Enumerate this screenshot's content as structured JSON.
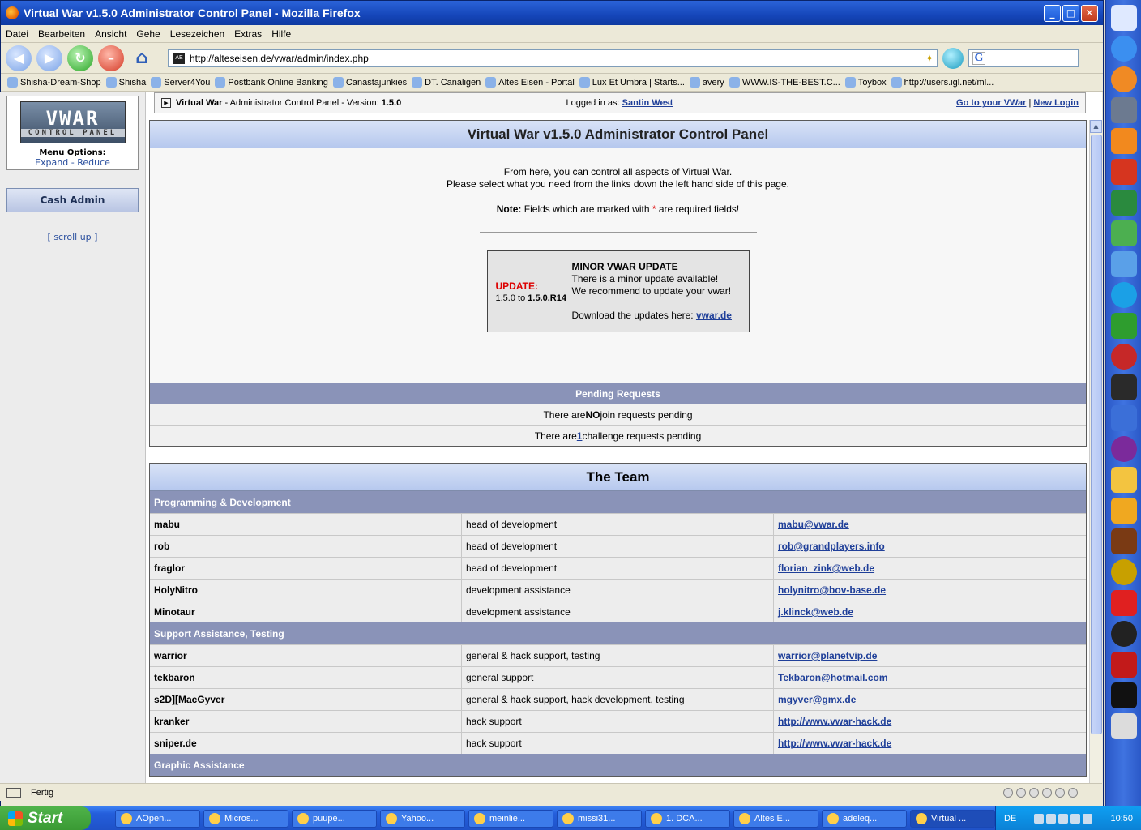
{
  "window": {
    "title": "Virtual War v1.5.0 Administrator Control Panel - Mozilla Firefox"
  },
  "menu": [
    "Datei",
    "Bearbeiten",
    "Ansicht",
    "Gehe",
    "Lesezeichen",
    "Extras",
    "Hilfe"
  ],
  "nav": {
    "url": "http://alteseisen.de/vwar/admin/index.php",
    "search_engine": "G"
  },
  "bookmarks": [
    "Shisha-Dream-Shop",
    "Shisha",
    "Server4You",
    "Postbank Online Banking",
    "Canastajunkies",
    "DT. Canaligen",
    "Altes Eisen - Portal",
    "Lux Et Umbra | Starts...",
    "avery",
    "WWW.IS-THE-BEST.C...",
    "Toybox",
    "http://users.igl.net/ml..."
  ],
  "sidebar": {
    "logo_main": "VWAR",
    "logo_sub": "CONTROL PANEL",
    "menu_options": "Menu Options:",
    "expand": "Expand",
    "sep": "-",
    "reduce": "Reduce",
    "cash_admin": "Cash Admin",
    "scroll_up": "scroll up"
  },
  "infobar": {
    "prefix": "Virtual War",
    "text": " - Administrator Control Panel - Version: ",
    "version": "1.5.0",
    "logged_in_label": "Logged in as: ",
    "user": "Santin West",
    "goto": "Go to your VWar",
    "sep": " | ",
    "new_login": "New Login"
  },
  "main_panel": {
    "title": "Virtual War v1.5.0 Administrator Control Panel",
    "line1": "From here, you can control all aspects of Virtual War.",
    "line2": "Please select what you need from the links down the left hand side of this page.",
    "note_label": "Note:",
    "note_text": " Fields which are marked with ",
    "note_star": "*",
    "note_end": " are required fields!",
    "update": {
      "label": "UPDATE:",
      "from": "1.5.0",
      "to_word": " to ",
      "to": "1.5.0.R14",
      "heading": "MINOR VWAR UPDATE",
      "line1": "There is a minor update available!",
      "line2": "We recommend to update your vwar!",
      "download_text": "Download the updates here: ",
      "download_link": "vwar.de"
    },
    "pending_title": "Pending Requests",
    "join_pre": "There are ",
    "join_count": "NO",
    "join_post": " join requests pending",
    "chal_pre": "There are ",
    "chal_count": "1",
    "chal_post": " challenge requests pending"
  },
  "team": {
    "title": "The Team",
    "groups": [
      {
        "name": "Programming & Development",
        "members": [
          {
            "name": "mabu",
            "role": "head of development",
            "contact": "mabu@vwar.de"
          },
          {
            "name": "rob",
            "role": "head of development",
            "contact": "rob@grandplayers.info"
          },
          {
            "name": "fraglor",
            "role": "head of development",
            "contact": "florian_zink@web.de"
          },
          {
            "name": "HolyNitro",
            "role": "development assistance",
            "contact": "holynitro@bov-base.de"
          },
          {
            "name": "Minotaur",
            "role": "development assistance",
            "contact": "j.klinck@web.de"
          }
        ]
      },
      {
        "name": "Support Assistance, Testing",
        "members": [
          {
            "name": "warrior",
            "role": "general & hack support, testing",
            "contact": "warrior@planetvip.de"
          },
          {
            "name": "tekbaron",
            "role": "general support",
            "contact": "Tekbaron@hotmail.com"
          },
          {
            "name": "s2D][MacGyver",
            "role": "general & hack support, hack development, testing",
            "contact": "mgyver@gmx.de"
          },
          {
            "name": "kranker",
            "role": "hack support",
            "contact": "http://www.vwar-hack.de"
          },
          {
            "name": "sniper.de",
            "role": "hack support",
            "contact": "http://www.vwar-hack.de"
          }
        ]
      },
      {
        "name": "Graphic Assistance",
        "members": []
      }
    ]
  },
  "status": {
    "text": "Fertig"
  },
  "taskbar": {
    "start": "Start",
    "tasks": [
      "AOpen...",
      "Micros...",
      "puupe...",
      "Yahoo...",
      "meinlie...",
      "missi31...",
      "1. DCA...",
      "Altes E...",
      "adeleq...",
      "Virtual ..."
    ],
    "lang": "DE",
    "clock": "10:50"
  }
}
